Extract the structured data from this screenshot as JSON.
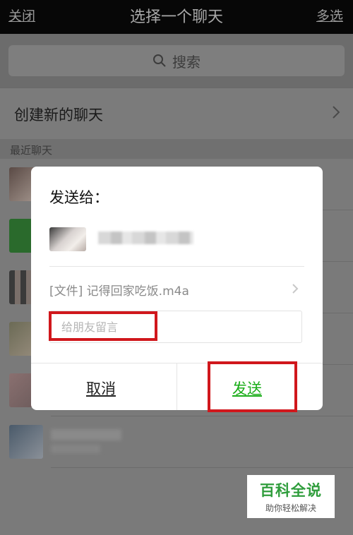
{
  "topbar": {
    "close": "关闭",
    "title": "选择一个聊天",
    "multi": "多选"
  },
  "search": {
    "placeholder": "搜索"
  },
  "new_chat": {
    "label": "创建新的聊天"
  },
  "recent": {
    "label": "最近聊天"
  },
  "dialog": {
    "heading": "发送给：",
    "file_line": "[文件] 记得回家吃饭.m4a",
    "message_placeholder": "给朋友留言",
    "cancel": "取消",
    "send": "发送"
  },
  "watermark": {
    "brand": "百科全说",
    "slogan": "助你轻松解决"
  },
  "colors": {
    "accent": "#1aad19",
    "highlight": "#d0171c"
  }
}
